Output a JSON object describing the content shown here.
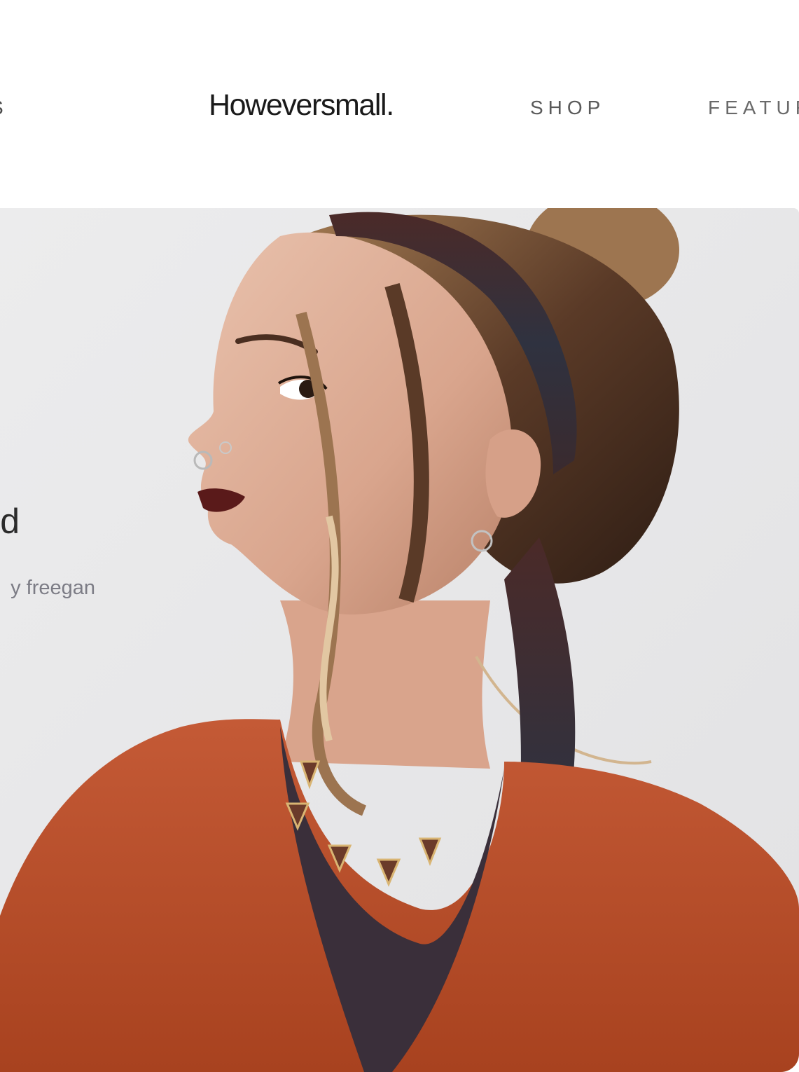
{
  "header": {
    "nav_left_label": "S",
    "logo_text": "Howeversmall.",
    "nav_shop_label": "SHOP",
    "nav_features_label": "FEATUR"
  },
  "hero": {
    "heading_fragment": "d.",
    "subtext_fragment": "y freegan"
  }
}
